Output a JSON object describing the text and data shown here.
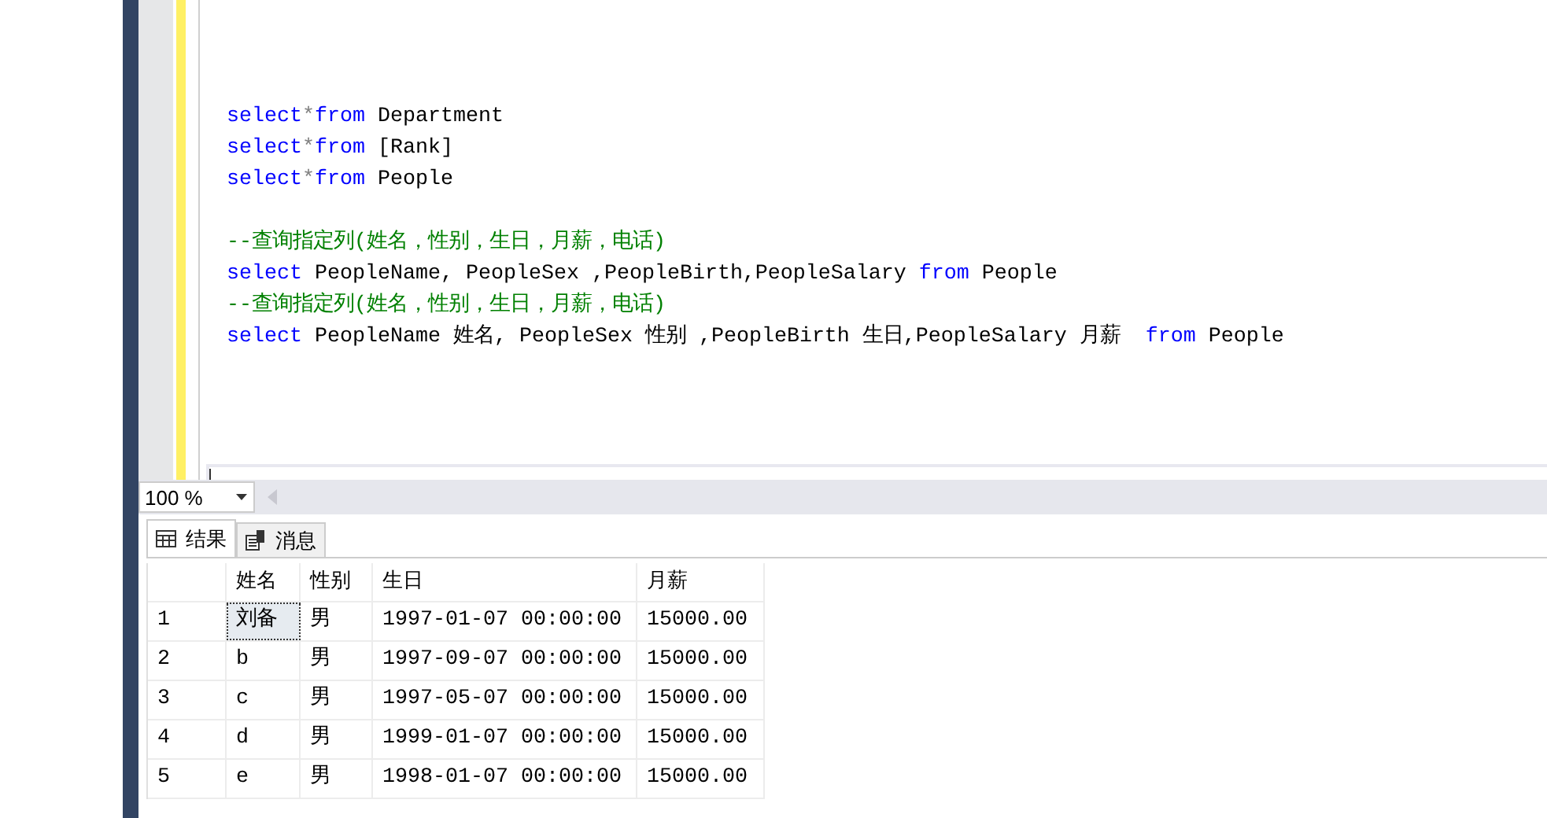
{
  "editor": {
    "lines": [
      {
        "kind": "blank"
      },
      {
        "kind": "blank"
      },
      {
        "kind": "code",
        "segments": [
          {
            "kind": "keyword",
            "text": "select"
          },
          {
            "kind": "op",
            "text": "*"
          },
          {
            "kind": "keyword",
            "text": "from"
          },
          {
            "kind": "plain",
            "text": " Department"
          }
        ]
      },
      {
        "kind": "code",
        "segments": [
          {
            "kind": "keyword",
            "text": "select"
          },
          {
            "kind": "op",
            "text": "*"
          },
          {
            "kind": "keyword",
            "text": "from"
          },
          {
            "kind": "plain",
            "text": " [Rank]"
          }
        ]
      },
      {
        "kind": "code",
        "segments": [
          {
            "kind": "keyword",
            "text": "select"
          },
          {
            "kind": "op",
            "text": "*"
          },
          {
            "kind": "keyword",
            "text": "from"
          },
          {
            "kind": "plain",
            "text": " People"
          }
        ]
      },
      {
        "kind": "blank"
      },
      {
        "kind": "code",
        "segments": [
          {
            "kind": "comment",
            "text": "--查询指定列(姓名，性别，生日，月薪，电话)"
          }
        ]
      },
      {
        "kind": "code",
        "segments": [
          {
            "kind": "keyword",
            "text": "select"
          },
          {
            "kind": "plain",
            "text": " PeopleName, PeopleSex ,PeopleBirth,PeopleSalary "
          },
          {
            "kind": "keyword",
            "text": "from"
          },
          {
            "kind": "plain",
            "text": " People"
          }
        ]
      },
      {
        "kind": "code",
        "segments": [
          {
            "kind": "comment",
            "text": "--查询指定列(姓名，性别，生日，月薪，电话)"
          }
        ]
      },
      {
        "kind": "code",
        "segments": [
          {
            "kind": "keyword",
            "text": "select"
          },
          {
            "kind": "plain",
            "text": " PeopleName 姓名, PeopleSex 性别 ,PeopleBirth 生日,PeopleSalary 月薪  "
          },
          {
            "kind": "keyword",
            "text": "from"
          },
          {
            "kind": "plain",
            "text": " People"
          }
        ]
      },
      {
        "kind": "blank"
      },
      {
        "kind": "blank"
      },
      {
        "kind": "blank"
      },
      {
        "kind": "current"
      }
    ]
  },
  "zoom": {
    "value": "100 %"
  },
  "tabs": [
    {
      "label": "结果",
      "selected": true
    },
    {
      "label": "消息",
      "selected": false
    }
  ],
  "results": {
    "columns": [
      "姓名",
      "性别",
      "生日",
      "月薪"
    ],
    "rows": [
      {
        "number": "1",
        "cells": [
          {
            "text": "刘备",
            "selected": true
          },
          {
            "text": "男",
            "selected": false
          },
          {
            "text": "1997-01-07 00:00:00",
            "selected": false
          },
          {
            "text": "15000.00",
            "selected": false
          }
        ]
      },
      {
        "number": "2",
        "cells": [
          {
            "text": "b",
            "selected": false
          },
          {
            "text": "男",
            "selected": false
          },
          {
            "text": "1997-09-07 00:00:00",
            "selected": false
          },
          {
            "text": "15000.00",
            "selected": false
          }
        ]
      },
      {
        "number": "3",
        "cells": [
          {
            "text": "c",
            "selected": false
          },
          {
            "text": "男",
            "selected": false
          },
          {
            "text": "1997-05-07 00:00:00",
            "selected": false
          },
          {
            "text": "15000.00",
            "selected": false
          }
        ]
      },
      {
        "number": "4",
        "cells": [
          {
            "text": "d",
            "selected": false
          },
          {
            "text": "男",
            "selected": false
          },
          {
            "text": "1999-01-07 00:00:00",
            "selected": false
          },
          {
            "text": "15000.00",
            "selected": false
          }
        ]
      },
      {
        "number": "5",
        "cells": [
          {
            "text": "e",
            "selected": false
          },
          {
            "text": "男",
            "selected": false
          },
          {
            "text": "1998-01-07 00:00:00",
            "selected": false
          },
          {
            "text": "15000.00",
            "selected": false
          }
        ]
      }
    ]
  }
}
